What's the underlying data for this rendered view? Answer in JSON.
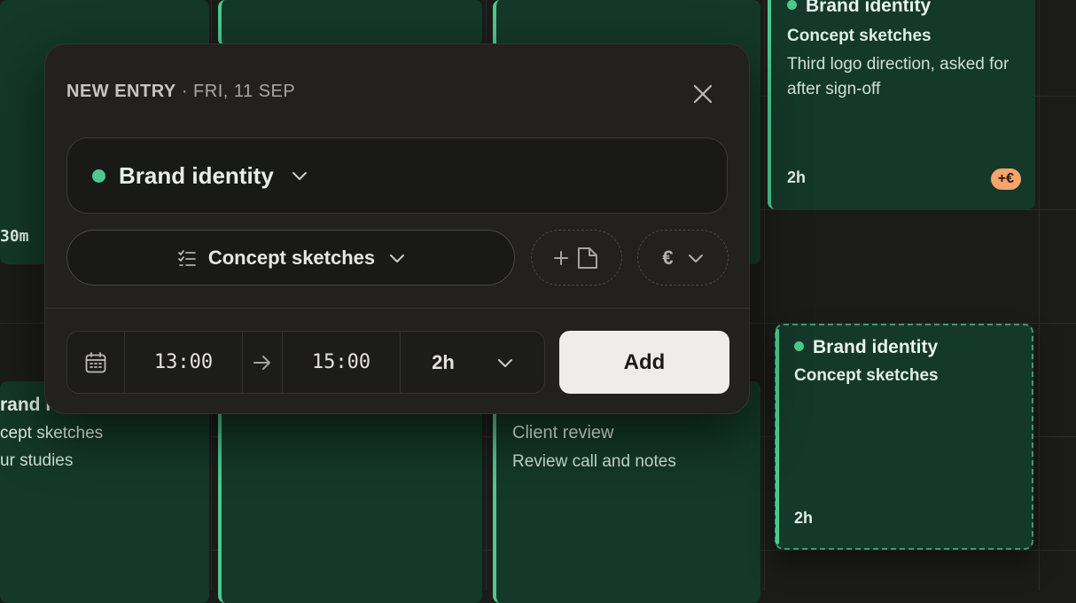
{
  "calendar": {
    "top_right_event": {
      "project": "Brand identity",
      "task": "Concept sketches",
      "note": "Third logo direction, asked for after sign-off",
      "duration": "2h",
      "badge": "+€"
    },
    "left_event_top": {
      "duration": "30m"
    },
    "left_event_bottom": {
      "project": "rand id",
      "task": "cept sketches",
      "note": "ur studies"
    },
    "middle_event": {
      "task": "Client review",
      "note": "Review call and notes"
    },
    "draft_event": {
      "project": "Brand identity",
      "task": "Concept sketches",
      "duration": "2h"
    }
  },
  "popup": {
    "header_title": "NEW ENTRY",
    "header_date": " · FRI, 11 SEP",
    "project_value": "Brand identity",
    "task_value": "Concept sketches",
    "currency_symbol": "€",
    "start_time": "13:00",
    "end_time": "15:00",
    "duration": "2h",
    "add_label": "Add"
  },
  "colors": {
    "accent": "#4cc98e",
    "event_bg": "#14382a",
    "badge": "#f4a46c",
    "popup_bg": "#222120"
  }
}
